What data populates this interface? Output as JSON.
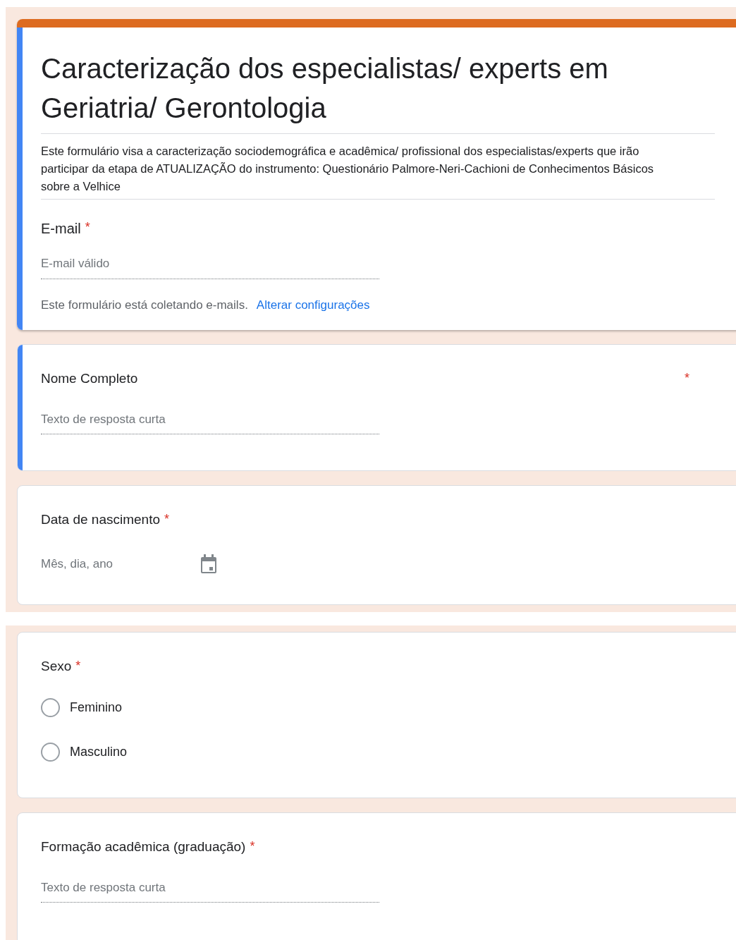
{
  "panels": [
    {
      "header": {
        "title": "Caracterização dos especialistas/ experts em Geriatria/ Gerontologia",
        "description": "Este formulário visa a caracterização sociodemográfica e acadêmica/ profissional dos especialistas/experts que irão participar da etapa de ATUALIZAÇÃO do instrumento: Questionário Palmore-Neri-Cachioni de Conhecimentos Básicos sobre a Velhice",
        "email_label": "E-mail",
        "email_required_mark": "*",
        "email_placeholder": "E-mail válido",
        "collecting_note": "Este formulário está coletando e-mails.",
        "settings_link": "Alterar configurações",
        "selected": true
      },
      "questions": [
        {
          "kind": "text",
          "title": "Nome Completo",
          "required_mark": "*",
          "selected": true,
          "placeholder": "Texto de resposta curta"
        },
        {
          "kind": "date",
          "title": "Data de nascimento",
          "required_mark": "*",
          "selected": false,
          "placeholder": "Mês, dia, ano"
        }
      ]
    },
    {
      "questions": [
        {
          "kind": "radio",
          "title": "Sexo",
          "required_mark": "*",
          "selected": false,
          "options": [
            {
              "label": "Feminino",
              "selected": false
            },
            {
              "label": "Masculino",
              "selected": false
            }
          ]
        },
        {
          "kind": "text",
          "title": "Formação acadêmica (graduação)",
          "required_mark": "*",
          "selected": false,
          "placeholder": "Texto de resposta curta"
        }
      ]
    }
  ]
}
